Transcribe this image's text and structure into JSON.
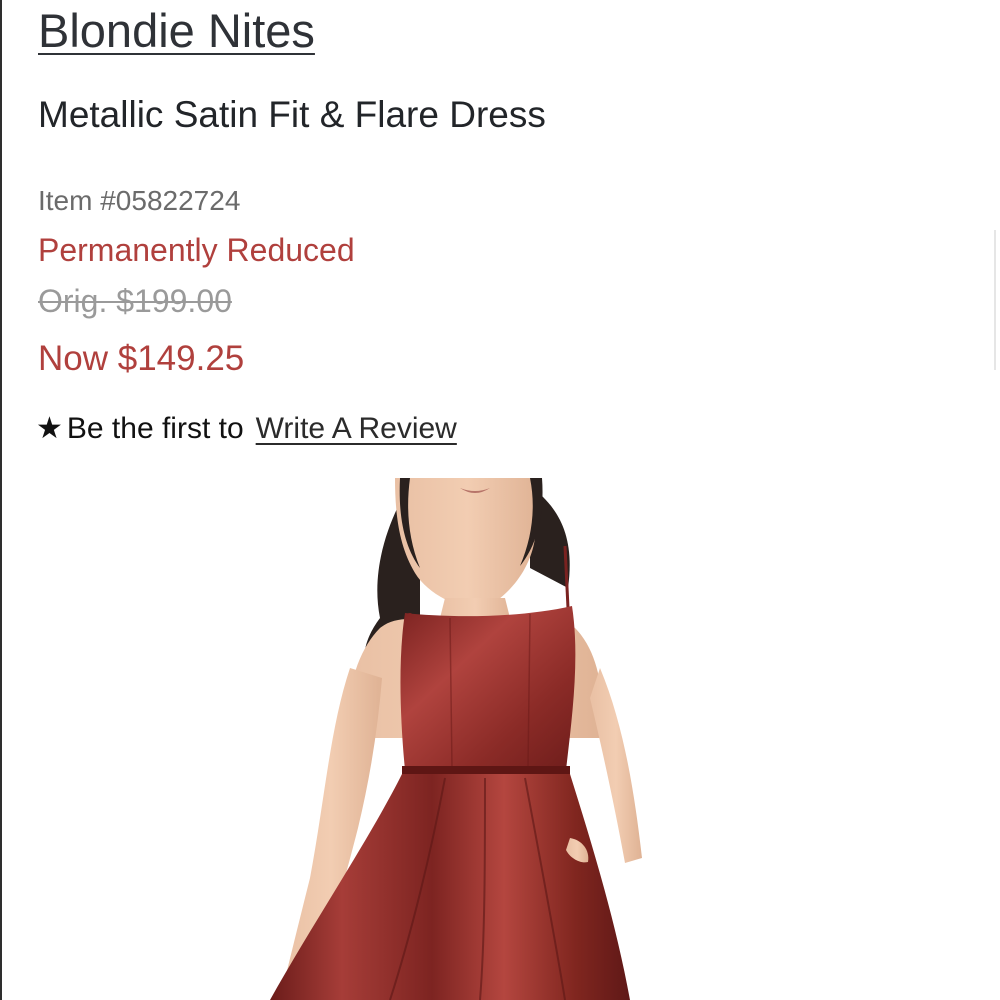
{
  "product": {
    "brand": "Blondie Nites",
    "title": "Metallic Satin Fit & Flare Dress",
    "item_number": "Item #05822724",
    "price_status": "Permanently Reduced",
    "original_price": "Orig. $199.00",
    "current_price": "Now $149.25"
  },
  "reviews": {
    "star_icon": "star-icon",
    "prompt": "Be the first to",
    "link_label": "Write A Review"
  },
  "colors": {
    "sale_red": "#b0403d",
    "dress_red": "#8f2a27",
    "text_dark": "#2b2b2b",
    "muted_gray": "#9a9a9a"
  }
}
